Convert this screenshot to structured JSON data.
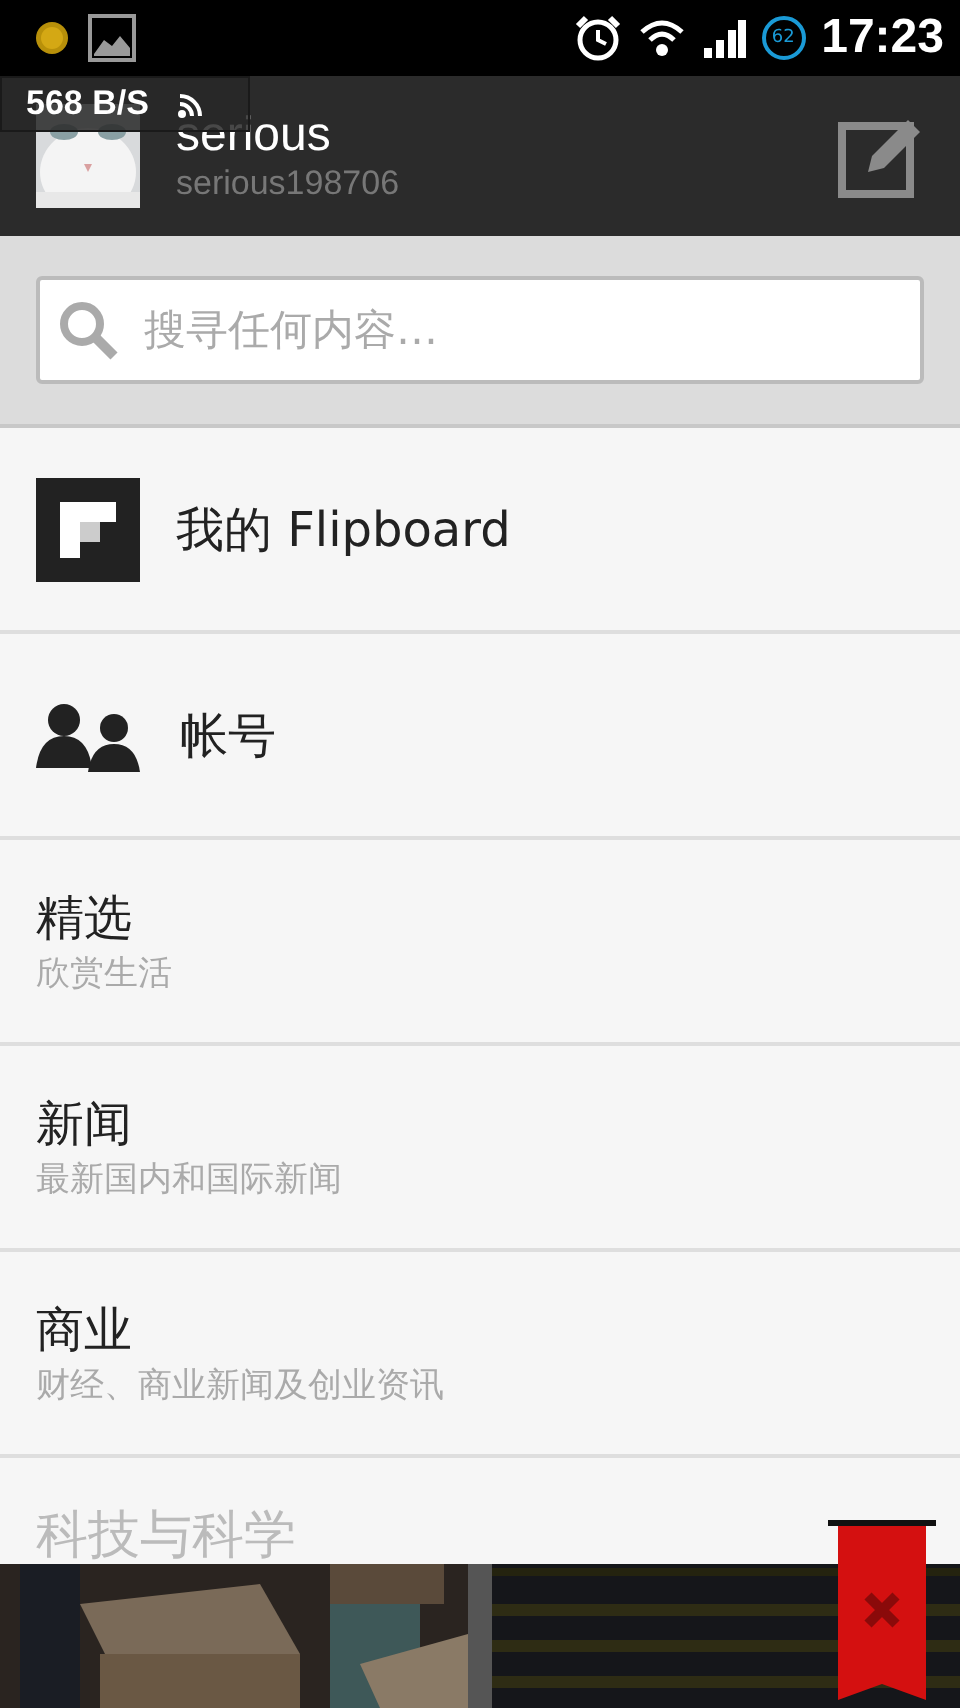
{
  "status_bar": {
    "battery_level_text": "62",
    "time": "17:23"
  },
  "speed_overlay": {
    "text": "568 B/S"
  },
  "profile": {
    "name": "serious",
    "username": "serious198706"
  },
  "search": {
    "placeholder": "搜寻任何内容…"
  },
  "menu": [
    {
      "kind": "flipboard",
      "title": "我的 Flipboard"
    },
    {
      "kind": "accounts",
      "title": "帐号"
    },
    {
      "kind": "category",
      "title": "精选",
      "subtitle": "欣赏生活"
    },
    {
      "kind": "category",
      "title": "新闻",
      "subtitle": "最新国内和国际新闻"
    },
    {
      "kind": "category",
      "title": "商业",
      "subtitle": "财经、商业新闻及创业资讯"
    },
    {
      "kind": "faded",
      "title": "科技与科学"
    }
  ]
}
